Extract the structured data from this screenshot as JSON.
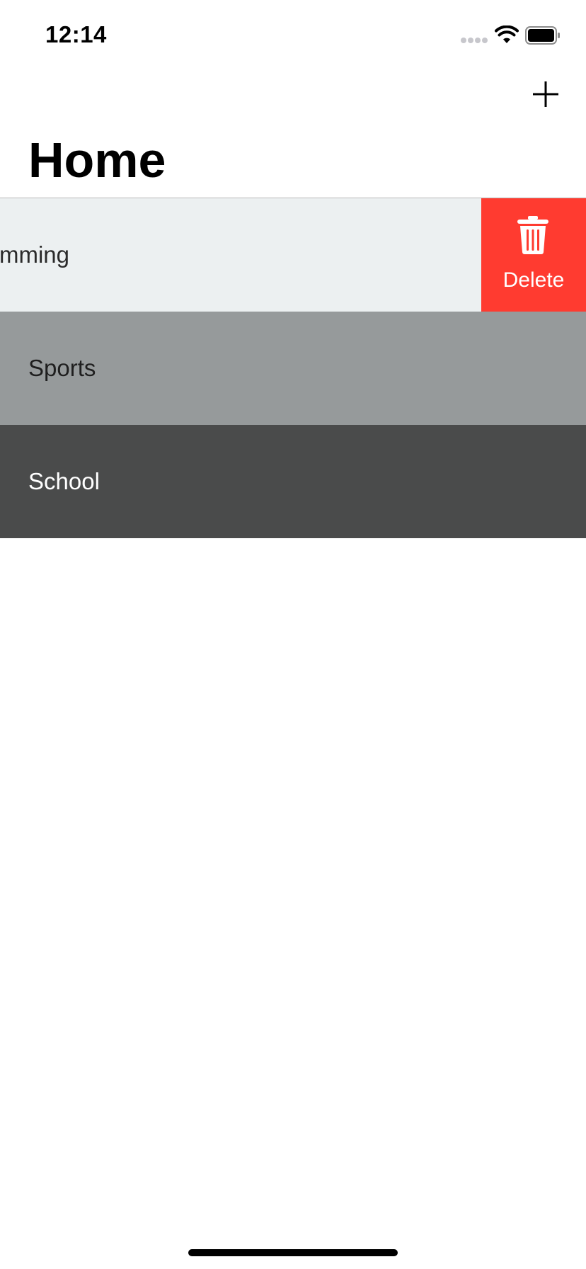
{
  "status_bar": {
    "time": "12:14",
    "signal_icon": "cellular-dots-icon",
    "wifi_icon": "wifi-icon",
    "battery_icon": "battery-icon"
  },
  "nav": {
    "title": "Home",
    "add_icon": "plus-icon"
  },
  "list": {
    "rows": [
      {
        "label": "mming",
        "background": "#ecf0f1"
      },
      {
        "label": "Sports",
        "background": "#969a9b"
      },
      {
        "label": "School",
        "background": "#4a4b4b"
      }
    ],
    "swipe_action": {
      "label": "Delete",
      "icon": "trash-icon",
      "color": "#ff3b30"
    }
  }
}
